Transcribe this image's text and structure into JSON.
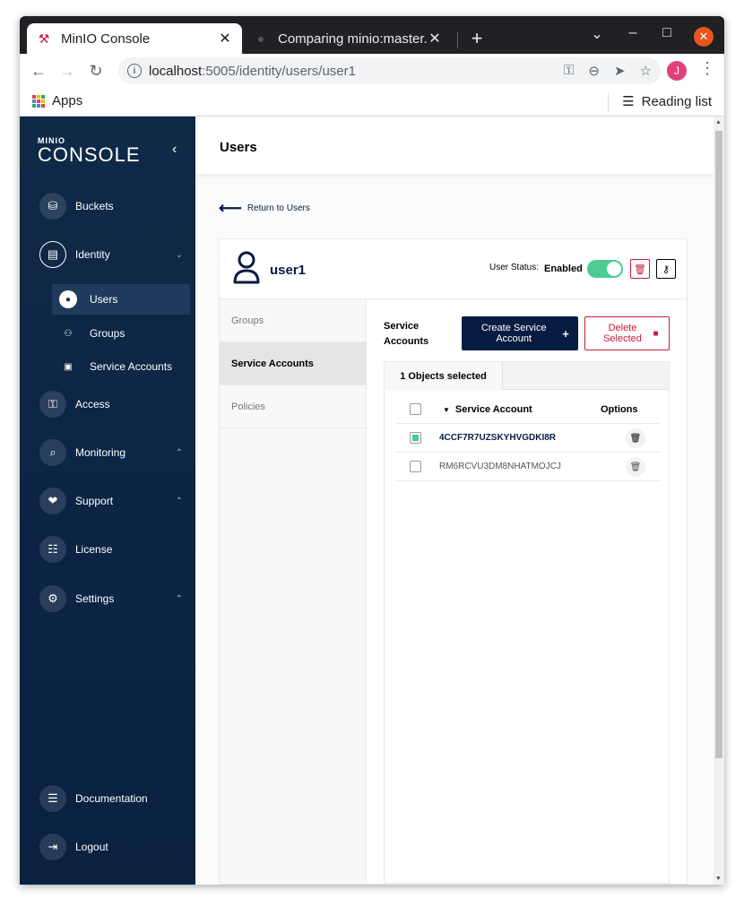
{
  "browser": {
    "tabs": [
      {
        "title": "MinIO Console",
        "active": true
      },
      {
        "title": "Comparing minio:master...",
        "active": false
      }
    ],
    "url_host": "localhost",
    "url_rest": ":5005/identity/users/user1",
    "profile_initial": "J",
    "bookmarks": {
      "apps": "Apps",
      "reading_list": "Reading list"
    }
  },
  "sidebar": {
    "logo_top": "MINIO",
    "logo_main": "CONSOLE",
    "items": [
      {
        "label": "Buckets"
      },
      {
        "label": "Identity"
      },
      {
        "label": "Access"
      },
      {
        "label": "Monitoring"
      },
      {
        "label": "Support"
      },
      {
        "label": "License"
      },
      {
        "label": "Settings"
      },
      {
        "label": "Documentation"
      },
      {
        "label": "Logout"
      }
    ],
    "identity_sub": [
      {
        "label": "Users",
        "active": true
      },
      {
        "label": "Groups"
      },
      {
        "label": "Service Accounts"
      }
    ]
  },
  "page": {
    "title": "Users",
    "return_link": "Return to Users"
  },
  "user": {
    "name": "user1",
    "status_label": "User Status:",
    "status_value": "Enabled",
    "enabled": true
  },
  "tabs": [
    {
      "label": "Groups"
    },
    {
      "label": "Service Accounts",
      "active": true
    },
    {
      "label": "Policies"
    }
  ],
  "service_accounts": {
    "title": "Service Accounts",
    "create_label": "Create Service Account",
    "delete_label": "Delete Selected",
    "selected_text": "1 Objects selected",
    "columns": [
      "Service Account",
      "Options"
    ],
    "rows": [
      {
        "id": "4CCF7R7UZSKYHVGDKI8R",
        "selected": true
      },
      {
        "id": "RM6RCVU3DM8NHATMOJCJ",
        "selected": false
      }
    ]
  },
  "colors": {
    "sidebar": "#0f2a47",
    "accent": "#081c42",
    "toggle_on": "#4ccb92",
    "danger": "#c51b3f"
  }
}
